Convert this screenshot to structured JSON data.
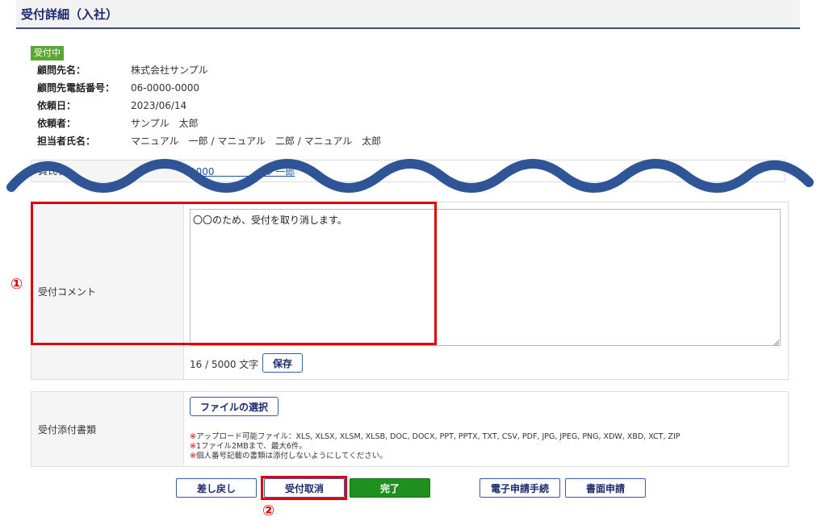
{
  "header": {
    "title": "受付詳細（入社）"
  },
  "status": {
    "label": "受付中",
    "color": "#5aa832"
  },
  "info": [
    {
      "label": "顧問先名：",
      "value": "株式会社サンプル"
    },
    {
      "label": "顧問先電話番号：",
      "value": "06-0000-0000"
    },
    {
      "label": "依頼日：",
      "value": "2023/06/14"
    },
    {
      "label": "依頼者：",
      "value": "サンプル　太郎"
    },
    {
      "label": "担当者氏名：",
      "value": "マニュアル　一郎 / マニュアル　二郎 / マニュアル　太郎"
    }
  ],
  "person": {
    "label": "員氏名",
    "link": "1000　　　　　ル 一郎"
  },
  "comment": {
    "label": "受付コメント",
    "value": "〇〇のため、受付を取り消します。",
    "char_count": "16 / 5000 文字",
    "save_label": "保存"
  },
  "attachments": {
    "label": "受付添付書類",
    "file_button_label": "ファイルの選択",
    "notes": [
      "アップロード可能ファイル：XLS, XLSX, XLSM, XLSB, DOC, DOCX, PPT, PPTX, TXT, CSV, PDF, JPG, JPEG, PNG, XDW, XBD, XCT, ZIP",
      "1ファイル2MBまで、最大6件。",
      "個人番号記載の書類は添付しないようにしてください。"
    ],
    "note_mark": "※"
  },
  "actions": {
    "return_label": "差し戻し",
    "cancel_label": "受付取消",
    "complete_label": "完了",
    "electronic_label": "電子申請手続",
    "paper_label": "書面申請"
  },
  "annotations": {
    "marker1": "①",
    "marker2": "②"
  },
  "colors": {
    "accent": "#1a2a6c",
    "highlight": "#e00000",
    "wave": "#2f5597",
    "complete": "#1f8f1f"
  }
}
